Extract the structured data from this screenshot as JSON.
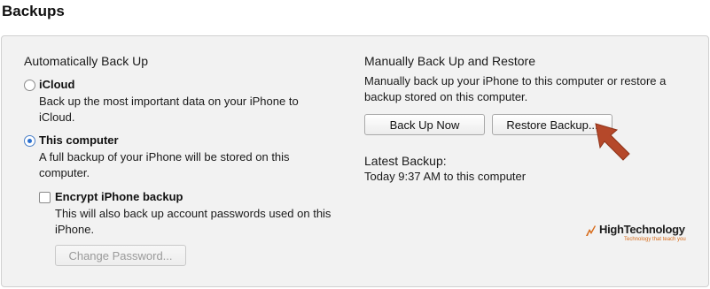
{
  "section": {
    "title": "Backups"
  },
  "auto": {
    "heading": "Automatically Back Up",
    "icloud": {
      "label": "iCloud",
      "desc_line1": "Back up the most important data on your iPhone to",
      "desc_line2": "iCloud.",
      "selected": false
    },
    "computer": {
      "label": "This computer",
      "desc_line1": "A full backup of your iPhone will be stored on this",
      "desc_line2": "computer.",
      "selected": true
    },
    "encrypt": {
      "label": "Encrypt iPhone backup",
      "desc_line1": "This will also back up account passwords used on this",
      "desc_line2": "iPhone.",
      "checked": false
    },
    "change_password_label": "Change Password..."
  },
  "manual": {
    "heading": "Manually Back Up and Restore",
    "desc_line1": "Manually back up your iPhone to this computer or restore a",
    "desc_line2": "backup stored on this computer.",
    "back_up_now_label": "Back Up Now",
    "restore_label": "Restore Backup..."
  },
  "latest": {
    "heading": "Latest Backup:",
    "value": "Today 9:37 AM to this computer"
  },
  "watermark": {
    "name": "HighTechnology",
    "tagline": "Technology that teach you"
  },
  "colors": {
    "arrow": "#b5482a",
    "radio_selected": "#2a6fcf",
    "watermark_accent": "#d76b1a"
  }
}
